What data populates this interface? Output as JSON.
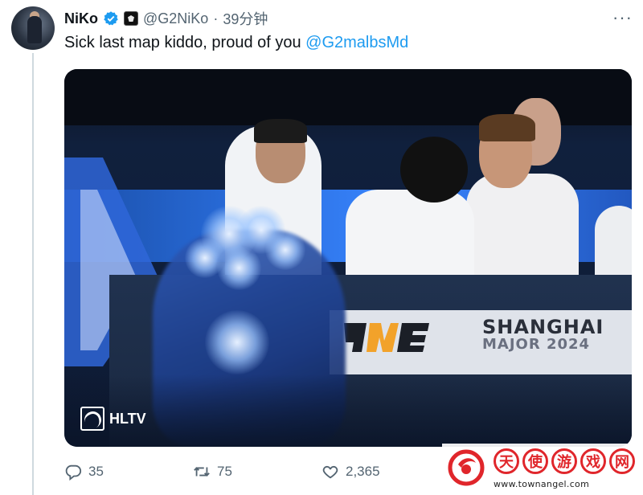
{
  "author": {
    "name": "NiKo",
    "handle": "@G2NiKo",
    "separator": "·",
    "time": "39分钟"
  },
  "tweet": {
    "text": "Sick last map kiddo, proud of you ",
    "mention": "@G2malbsMd"
  },
  "media": {
    "watermark": "HLTV",
    "event_banner_line1": "SHANGHAI",
    "event_banner_line2": "MAJOR 2024"
  },
  "actions": {
    "replies": "35",
    "retweets": "75",
    "likes": "2,365"
  },
  "overlay_watermark": {
    "chars": [
      "天",
      "使",
      "游",
      "戏",
      "网"
    ],
    "url": "www.townangel.com"
  },
  "colors": {
    "link": "#1d9bf0",
    "muted": "#536471",
    "verified": "#1d9bf0",
    "watermark_red": "#e0262b"
  },
  "icons": [
    "verified-badge-icon",
    "g2-affiliate-icon",
    "more-options-icon",
    "reply-icon",
    "retweet-icon",
    "like-icon",
    "hltv-logo-icon"
  ]
}
